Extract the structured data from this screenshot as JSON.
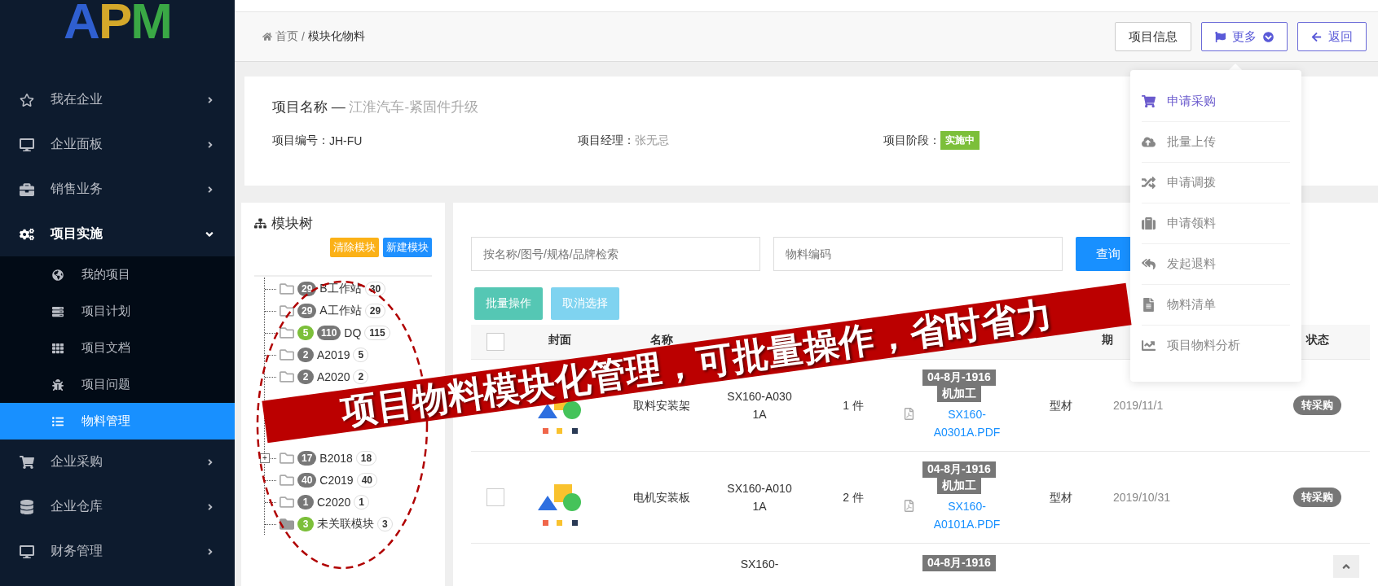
{
  "logo": [
    {
      "text": "A",
      "color": "#2f5fd0"
    },
    {
      "text": "P",
      "color": "#d4a82a"
    },
    {
      "text": "M",
      "color": "#3aa845"
    }
  ],
  "sidebar": {
    "items": [
      {
        "label": "我在企业",
        "expanded": false
      },
      {
        "label": "企业面板",
        "expanded": false
      },
      {
        "label": "销售业务",
        "expanded": false
      },
      {
        "label": "项目实施",
        "expanded": true,
        "children": [
          {
            "label": "我的项目",
            "selected": false
          },
          {
            "label": "项目计划",
            "selected": false
          },
          {
            "label": "项目文档",
            "selected": false
          },
          {
            "label": "项目问题",
            "selected": false
          },
          {
            "label": "物料管理",
            "selected": true
          }
        ]
      },
      {
        "label": "企业采购",
        "expanded": false
      },
      {
        "label": "企业仓库",
        "expanded": false
      },
      {
        "label": "财务管理",
        "expanded": false
      }
    ]
  },
  "breadcrumb": {
    "items": [
      "首页",
      "模块化物料"
    ],
    "separator": "/"
  },
  "header_buttons": [
    {
      "label": "项目信息",
      "kind": "plain"
    },
    {
      "label": "更多",
      "kind": "menu"
    },
    {
      "label": "返回",
      "kind": "back"
    }
  ],
  "project": {
    "title_label": "项目名称 — ",
    "title_value": "江淮汽车-紧固件升级",
    "fields": [
      {
        "label": "项目编号：",
        "value": "JH-FU",
        "kind": "text"
      },
      {
        "label": "项目经理：",
        "value": "张无忌",
        "kind": "blurred"
      },
      {
        "label": "项目阶段：",
        "value": "实施中",
        "kind": "badge"
      }
    ]
  },
  "tree": {
    "title": "模块树",
    "buttons": [
      {
        "label": "清除模块",
        "color": "#fbb117"
      },
      {
        "label": "新建模块",
        "color": "#1e90ff"
      }
    ],
    "items": [
      {
        "badges": [
          {
            "text": "29",
            "color": "#777777"
          }
        ],
        "label": "B工作站",
        "count": "30",
        "selected": false
      },
      {
        "badges": [
          {
            "text": "29",
            "color": "#777777"
          }
        ],
        "label": "A工作站",
        "count": "29",
        "selected": false
      },
      {
        "badges": [
          {
            "text": "5",
            "color": "#7cbf3a"
          },
          {
            "text": "110",
            "color": "#777777"
          }
        ],
        "label": "DQ",
        "count": "115",
        "selected": false
      },
      {
        "badges": [
          {
            "text": "2",
            "color": "#777777"
          }
        ],
        "label": "A2019",
        "count": "5",
        "selected": false
      },
      {
        "badges": [
          {
            "text": "2",
            "color": "#777777"
          }
        ],
        "label": "A2020",
        "count": "2",
        "selected": false
      },
      {
        "badges": [
          {
            "text": "17",
            "color": "#777777"
          }
        ],
        "label": "B2018",
        "count": "18",
        "expander": "+",
        "selected": false
      },
      {
        "badges": [
          {
            "text": "40",
            "color": "#777777"
          }
        ],
        "label": "C2019",
        "count": "40",
        "selected": false
      },
      {
        "badges": [
          {
            "text": "1",
            "color": "#777777"
          }
        ],
        "label": "C2020",
        "count": "1",
        "selected": false
      },
      {
        "badges": [
          {
            "text": "3",
            "color": "#7cbf3a"
          }
        ],
        "label": "未关联模块",
        "count": "3",
        "selected": true
      }
    ]
  },
  "search": {
    "fields": [
      {
        "placeholder": "按名称/图号/规格/品牌检索"
      },
      {
        "placeholder": "物料编码"
      }
    ],
    "button": "查询"
  },
  "actions": [
    {
      "label": "批量操作",
      "disabled": false
    },
    {
      "label": "取消选择",
      "disabled": true
    }
  ],
  "table": {
    "all_checked": false,
    "columns": [
      {
        "label": "封面"
      },
      {
        "label": "名称"
      },
      {},
      {},
      {},
      {},
      {
        "label": "期"
      },
      {
        "label": "状态"
      }
    ],
    "rows": [
      {
        "name": "取料安装架",
        "spec": "SX160-A0301A",
        "qty": "1 件",
        "code": "04-8月-1916",
        "process": "机加工",
        "file": "SX160-A0301A.PDF",
        "material": "型材",
        "date": "2019/11/1",
        "status": "转采购"
      },
      {
        "checked": false,
        "name": "电机安装板",
        "spec": "SX160-A0101A",
        "qty": "2 件",
        "code": "04-8月-1916",
        "process": "机加工",
        "file": "SX160-A0101A.PDF",
        "material": "型材",
        "date": "2019/10/31",
        "status": "转采购"
      },
      {
        "spec": "SX160-",
        "code": "04-8月-1916"
      }
    ]
  },
  "menu": {
    "items": [
      {
        "label": "申请采购",
        "selected": true
      },
      {
        "label": "批量上传",
        "selected": false
      },
      {
        "label": "申请调拨",
        "selected": false
      },
      {
        "label": "申请领料",
        "selected": false
      },
      {
        "label": "发起退料",
        "selected": false
      },
      {
        "label": "物料清单",
        "selected": false
      },
      {
        "label": "项目物料分析",
        "selected": false
      }
    ]
  },
  "banner": "项目物料模块化管理，可批量操作，省时省力"
}
